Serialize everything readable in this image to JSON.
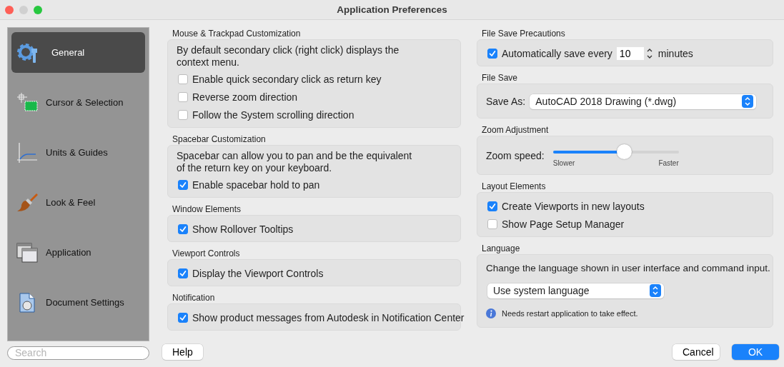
{
  "window": {
    "title": "Application Preferences"
  },
  "sidebar": {
    "items": [
      {
        "label": "General",
        "selected": true
      },
      {
        "label": "Cursor & Selection",
        "selected": false
      },
      {
        "label": "Units & Guides",
        "selected": false
      },
      {
        "label": "Look & Feel",
        "selected": false
      },
      {
        "label": "Application",
        "selected": false
      },
      {
        "label": "Document Settings",
        "selected": false
      }
    ],
    "search": {
      "placeholder": "Search"
    }
  },
  "left_sections": [
    {
      "title": "Mouse & Trackpad Customization",
      "items": [
        {
          "kind": "text",
          "text": "By default secondary click (right click) displays the context menu."
        },
        {
          "kind": "checkbox",
          "label": "Enable quick secondary click as return key",
          "checked": false
        },
        {
          "kind": "checkbox",
          "label": "Reverse zoom direction",
          "checked": false
        },
        {
          "kind": "checkbox",
          "label": "Follow the System scrolling direction",
          "checked": false
        }
      ]
    },
    {
      "title": "Spacebar Customization",
      "items": [
        {
          "kind": "text",
          "text": "Spacebar can allow you to pan and be the equivalent of the return key on your keyboard."
        },
        {
          "kind": "checkbox",
          "label": "Enable spacebar hold to pan",
          "checked": true
        }
      ]
    },
    {
      "title": "Window Elements",
      "items": [
        {
          "kind": "checkbox",
          "label": "Show Rollover Tooltips",
          "checked": true
        }
      ]
    },
    {
      "title": "Viewport Controls",
      "items": [
        {
          "kind": "checkbox",
          "label": "Display the Viewport Controls",
          "checked": true
        }
      ]
    },
    {
      "title": "Notification",
      "items": [
        {
          "kind": "checkbox",
          "label": "Show product messages from Autodesk in Notification Center",
          "checked": true
        }
      ]
    }
  ],
  "right_sections": [
    {
      "title": "File Save Precautions",
      "items": [
        {
          "kind": "stepper",
          "label": "Automatically save every",
          "checked": true,
          "value": "10",
          "suffix": "minutes"
        }
      ]
    },
    {
      "title": "File Save",
      "items": [
        {
          "kind": "select",
          "label": "Save As:",
          "value": "AutoCAD 2018 Drawing (*.dwg)"
        }
      ]
    },
    {
      "title": "Zoom Adjustment",
      "items": [
        {
          "kind": "slider",
          "label": "Zoom speed:",
          "level": 0.57,
          "min_label": "Slower",
          "max_label": "Faster"
        }
      ]
    },
    {
      "title": "Layout Elements",
      "items": [
        {
          "kind": "checkbox",
          "label": "Create Viewports in new layouts",
          "checked": true
        },
        {
          "kind": "checkbox",
          "label": "Show Page Setup Manager",
          "checked": false
        }
      ]
    },
    {
      "title": "Language",
      "items": [
        {
          "kind": "text",
          "text": "Change the language shown in user interface and command input."
        },
        {
          "kind": "select",
          "value": "Use system language"
        },
        {
          "kind": "note",
          "text": "Needs restart application to take effect."
        }
      ]
    }
  ],
  "buttons": {
    "help": "Help",
    "cancel": "Cancel",
    "ok": "OK"
  }
}
